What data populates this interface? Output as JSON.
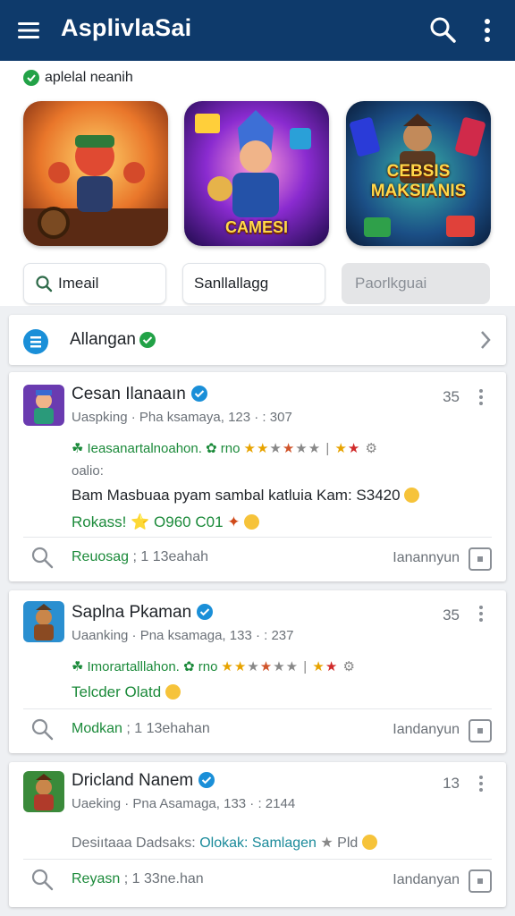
{
  "appbar": {
    "title": "AsplivlaSai"
  },
  "featured": {
    "label": "aplelal neanih",
    "tiles": [
      {
        "label": ""
      },
      {
        "label": "CAMESI"
      },
      {
        "label": "CEBSIS MAKSIANIS"
      }
    ]
  },
  "chips": [
    {
      "label": "Imeail"
    },
    {
      "label": "Sanllallagg"
    },
    {
      "label": "Paorlkguai"
    }
  ],
  "section": {
    "label": "Allangan"
  },
  "posts": [
    {
      "name": "Cesan Ilanaaın",
      "meta": "Uaspking · Pha ksamaya, 123 · : 307",
      "count": "35",
      "tagline": "Ieasanartalnoahon. ✿ rno",
      "tagline2": "oalio:",
      "body": "Bam Masbuaa pyam sambal katluia Kam: S3420",
      "sub": "Rokass! ⭐ O960 C01",
      "foot_left": "Reuosag",
      "foot_left_tail": "; 1 13eahah",
      "foot_right": "Ianannyun"
    },
    {
      "name": "Saplna Pkaman",
      "meta": "Uaanking · Pna ksamaga, 133 · : 237",
      "count": "35",
      "tagline": "Imorartalllahon. ✿ rno",
      "sub": "Telcder Olatd",
      "foot_left": "Modkan",
      "foot_left_tail": "; 1 13ehahan",
      "foot_right": "Iandanyun"
    },
    {
      "name": "Dricland Nanem",
      "meta": "Uaeking · Pna Asamaga, 133 · : 2144",
      "count": "13",
      "body_grey": "Desiıtaaa Dadsaks:",
      "body_teal": "Olokak: Samlagen",
      "body_tail": "Pld",
      "foot_left": "Reyasn",
      "foot_left_tail": "; 1 33ne.han",
      "foot_right": "Iandanyan"
    }
  ],
  "colors": {
    "appbar": "#0e3a6b",
    "accent_green": "#1b8a3a",
    "verified_blue": "#1a8fd8"
  }
}
